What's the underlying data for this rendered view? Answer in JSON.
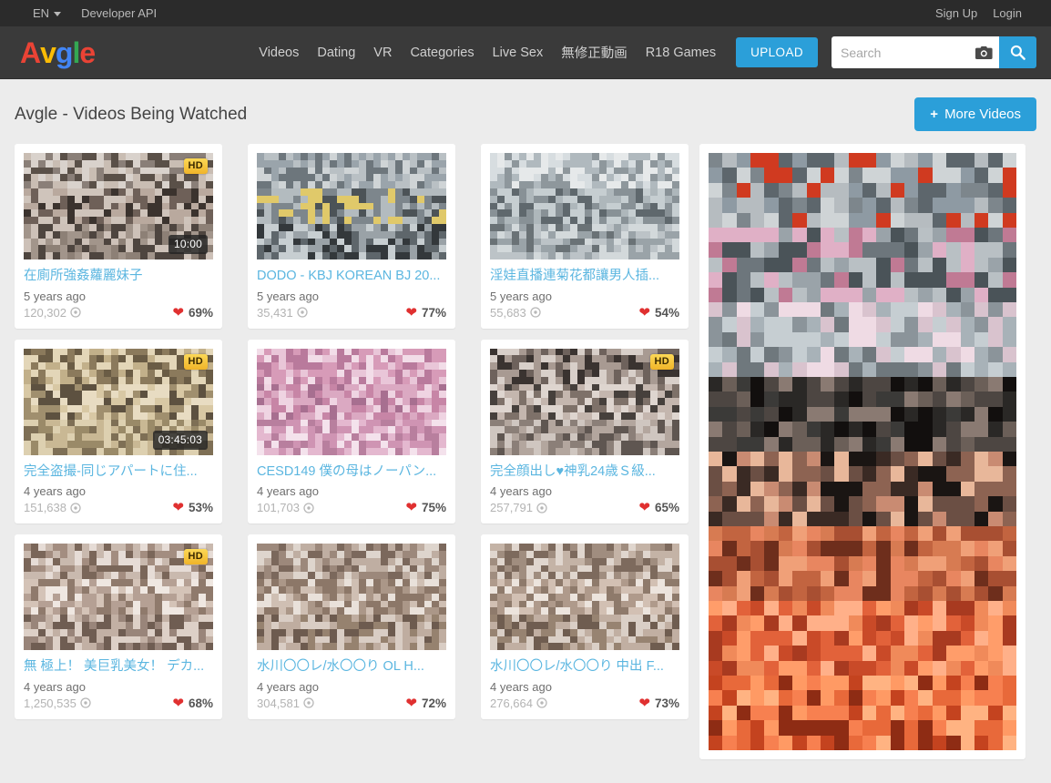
{
  "topbar": {
    "language": "EN",
    "developer_api": "Developer API",
    "sign_up": "Sign Up",
    "login": "Login"
  },
  "brand": {
    "letters": [
      {
        "char": "A",
        "color": "#ea4335"
      },
      {
        "char": "v",
        "color": "#fbbc05"
      },
      {
        "char": "g",
        "color": "#4285f4"
      },
      {
        "char": "l",
        "color": "#34a853"
      },
      {
        "char": "e",
        "color": "#ea4335"
      }
    ]
  },
  "nav": {
    "items": [
      {
        "label": "Videos"
      },
      {
        "label": "Dating"
      },
      {
        "label": "VR"
      },
      {
        "label": "Categories"
      },
      {
        "label": "Live Sex"
      },
      {
        "label": "無修正動画"
      },
      {
        "label": "R18 Games"
      }
    ],
    "upload_label": "UPLOAD"
  },
  "search": {
    "placeholder": "Search",
    "value": "",
    "camera_icon": "camera-icon",
    "submit_icon": "magnifier-icon"
  },
  "page": {
    "title": "Avgle - Videos Being Watched",
    "more_videos_label": "More Videos",
    "more_videos_plus": "+"
  },
  "colors": {
    "accent_blue": "#2b9fd9",
    "title_link": "#5bb6e0",
    "heart_red": "#e03030",
    "hd_badge": "#f0b429",
    "navbar_bg": "#3a3a3a",
    "topbar_bg": "#2b2b2b",
    "page_bg": "#ececec"
  },
  "videos": [
    {
      "title": "在廁所強姦蘿麗妹子",
      "age": "5 years ago",
      "views": "120,302",
      "likes": "69%",
      "duration": "10:00",
      "hd": "HD",
      "has_hd": true,
      "has_duration": true
    },
    {
      "title": "DODO - KBJ KOREAN BJ 20...",
      "age": "5 years ago",
      "views": "35,431",
      "likes": "77%",
      "duration": "",
      "hd": "HD",
      "has_hd": false,
      "has_duration": false
    },
    {
      "title": "淫娃直播連菊花都讓男人插...",
      "age": "5 years ago",
      "views": "55,683",
      "likes": "54%",
      "duration": "",
      "hd": "HD",
      "has_hd": false,
      "has_duration": false
    },
    {
      "title": "完全盗撮-同じアパートに住...",
      "age": "4 years ago",
      "views": "151,638",
      "likes": "53%",
      "duration": "03:45:03",
      "hd": "HD",
      "has_hd": true,
      "has_duration": true
    },
    {
      "title": "CESD149 僕の母はノーパン...",
      "age": "4 years ago",
      "views": "101,703",
      "likes": "75%",
      "duration": "",
      "hd": "HD",
      "has_hd": false,
      "has_duration": false
    },
    {
      "title": "完全顔出し♥神乳24歳Ｓ級...",
      "age": "4 years ago",
      "views": "257,791",
      "likes": "65%",
      "duration": "",
      "hd": "HD",
      "has_hd": true,
      "has_duration": false
    },
    {
      "title": "無 極上！ 美巨乳美女！ デカ...",
      "age": "4 years ago",
      "views": "1,250,535",
      "likes": "68%",
      "duration": "",
      "hd": "HD",
      "has_hd": true,
      "has_duration": false
    },
    {
      "title": "水川〇〇レ/水〇〇り OL H...",
      "age": "4 years ago",
      "views": "304,581",
      "likes": "72%",
      "duration": "",
      "hd": "HD",
      "has_hd": false,
      "has_duration": false
    },
    {
      "title": "水川〇〇レ/水〇〇り 中出 F...",
      "age": "4 years ago",
      "views": "276,664",
      "likes": "73%",
      "duration": "",
      "hd": "HD",
      "has_hd": false,
      "has_duration": false
    }
  ],
  "sidebar_ad": {
    "name": "advertisement-banner",
    "content": "censored-image"
  }
}
